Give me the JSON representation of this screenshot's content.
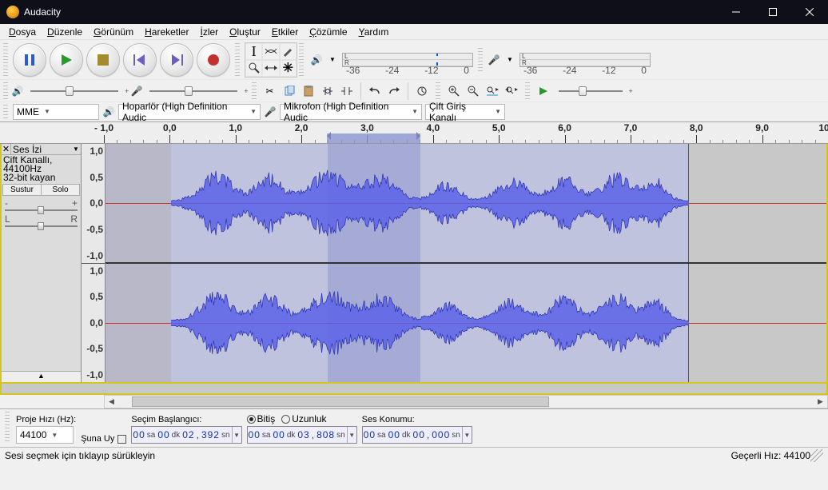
{
  "window": {
    "title": "Audacity"
  },
  "menu": {
    "items": [
      "Dosya",
      "Düzenle",
      "Görünüm",
      "Hareketler",
      "İzler",
      "Oluştur",
      "Etkiler",
      "Çözümle",
      "Yardım"
    ]
  },
  "transport": {
    "pause": "pause",
    "play": "play",
    "stop": "stop",
    "skip_start": "skip-start",
    "skip_end": "skip-end",
    "record": "record"
  },
  "tools_grid": [
    "I",
    "envelope",
    "draw",
    "zoom",
    "timeshift",
    "multi"
  ],
  "meters": {
    "db_ticks": [
      "-36",
      "-24",
      "-12",
      "0"
    ]
  },
  "device_row": {
    "host": "MME",
    "playback": "Hoparlör (High Definition Audic",
    "record_device": "Mikrofon (High Definition Audic",
    "channels": "Çift Giriş Kanalı"
  },
  "timeline": {
    "start": -1.0,
    "end": 10.0,
    "majors": [
      -1.0,
      0.0,
      1.0,
      2.0,
      3.0,
      4.0,
      5.0,
      6.0,
      7.0,
      8.0,
      9.0,
      10.0
    ],
    "labels": [
      "- 1,0",
      "0,0",
      "1,0",
      "2,0",
      "3,0",
      "4,0",
      "5,0",
      "6,0",
      "7,0",
      "8,0",
      "9,0",
      "10,0"
    ],
    "sel_start": 2.392,
    "sel_end": 3.808,
    "clip_end": 7.9
  },
  "track": {
    "name": "Ses İzi",
    "info1": "Çift Kanallı, 44100Hz",
    "info2": "32-bit kayan",
    "mute": "Sustur",
    "solo": "Solo",
    "vticks": [
      "1,0",
      "0,5",
      "0,0",
      "-0,5",
      "-1,0"
    ]
  },
  "bottom": {
    "proj_rate_label": "Proje Hızı (Hz):",
    "proj_rate": "44100",
    "snap_label": "Şuna Uy",
    "sel_start_label": "Seçim Başlangıcı:",
    "end_label": "Bitiş",
    "length_label": "Uzunluk",
    "audio_pos_label": "Ses Konumu:",
    "time_start": {
      "h": "00",
      "m": "00",
      "s": "02",
      "ms": "392"
    },
    "time_end": {
      "h": "00",
      "m": "00",
      "s": "03",
      "ms": "808"
    },
    "time_pos": {
      "h": "00",
      "m": "00",
      "s": "00",
      "ms": "000"
    },
    "unit_h": "sa",
    "unit_m": "dk",
    "unit_s": "sn"
  },
  "status": {
    "hint": "Sesi seçmek için tıklayıp sürükleyin",
    "rate_label": "Geçerli Hız:",
    "rate": "44100"
  }
}
